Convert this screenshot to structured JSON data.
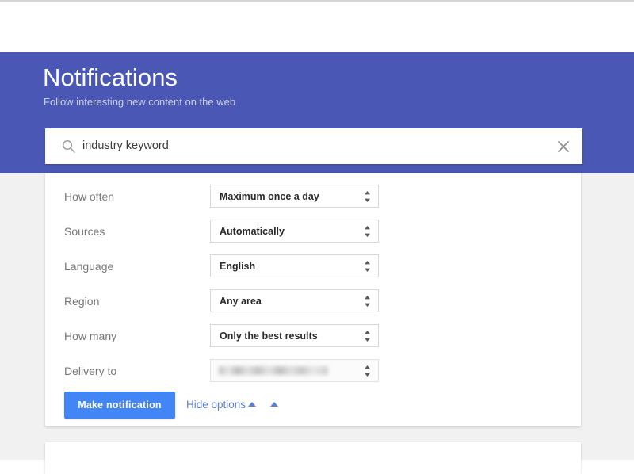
{
  "header": {
    "title": "Notifications",
    "subtitle": "Follow interesting new content on the web",
    "background_color": "#4a57b5"
  },
  "search": {
    "value": "industry keyword",
    "search_icon": "search-icon",
    "clear_icon": "close-icon"
  },
  "options": {
    "rows": [
      {
        "label": "How often",
        "value": "Maximum once a day",
        "redacted": false
      },
      {
        "label": "Sources",
        "value": "Automatically",
        "redacted": false
      },
      {
        "label": "Language",
        "value": "English",
        "redacted": false
      },
      {
        "label": "Region",
        "value": "Any area",
        "redacted": false
      },
      {
        "label": "How many",
        "value": "Only the best results",
        "redacted": false
      },
      {
        "label": "Delivery to",
        "value": "",
        "redacted": true
      }
    ]
  },
  "actions": {
    "make_notification_label": "Make notification",
    "hide_options_label": "Hide options",
    "button_color": "#4285f4",
    "link_color": "#5e7fd0"
  }
}
